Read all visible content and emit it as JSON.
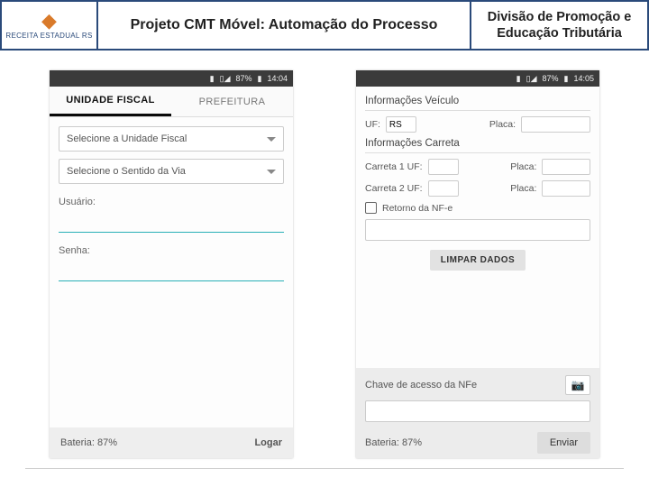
{
  "header": {
    "logo_text": "RECEITA ESTADUAL RS",
    "title": "Projeto CMT Móvel: Automação do Processo",
    "division_line1": "Divisão de Promoção e",
    "division_line2": "Educação Tributária"
  },
  "phoneA": {
    "status": {
      "battery_pct": "87%",
      "time": "14:04"
    },
    "tabs": {
      "active": "UNIDADE FISCAL",
      "inactive": "PREFEITURA"
    },
    "dropdown_unit": "Selecione a Unidade Fiscal",
    "dropdown_via": "Selecione o Sentido da Via",
    "label_user": "Usuário:",
    "label_pass": "Senha:",
    "footer_battery": "Bateria: 87%",
    "footer_action": "Logar"
  },
  "phoneB": {
    "status": {
      "battery_pct": "87%",
      "time": "14:05"
    },
    "section_vehicle": "Informações Veículo",
    "label_uf": "UF:",
    "value_uf": "RS",
    "label_placa": "Placa:",
    "section_trailer": "Informações Carreta",
    "label_carreta1": "Carreta 1 UF:",
    "label_carreta2": "Carreta 2 UF:",
    "label_retorno": "Retorno da NF-e",
    "btn_limpar": "LIMPAR DADOS",
    "label_chave": "Chave de acesso da NFe",
    "footer_battery": "Bateria: 87%",
    "footer_action": "Enviar"
  }
}
